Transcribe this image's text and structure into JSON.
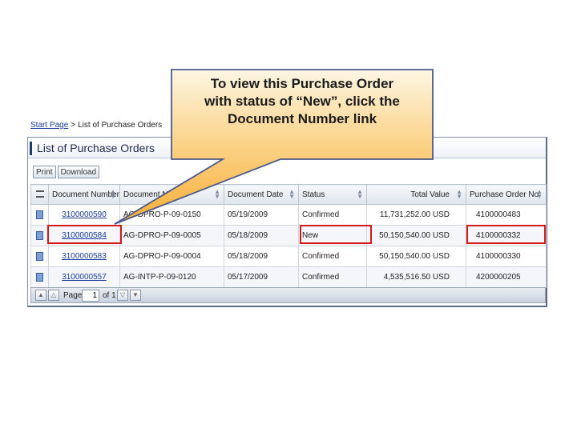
{
  "breadcrumb": {
    "start": "Start Page",
    "separator": ">",
    "current": "List of Purchase Orders"
  },
  "page_title": "List of Purchase Orders",
  "toolbar": {
    "print_label": "Print",
    "download_label": "Download"
  },
  "table": {
    "headers": [
      "Document Number",
      "Document Name",
      "Document Date",
      "Status",
      "Total Value",
      "Purchase Order No."
    ],
    "rows": [
      {
        "doc_number": "3100000590",
        "doc_name": "AG-DPRO-P-09-0150",
        "doc_date": "05/19/2009",
        "status": "Confirmed",
        "total_value": "11,731,252.00 USD",
        "po_number": "4100000483"
      },
      {
        "doc_number": "3100000584",
        "doc_name": "AG-DPRO-P-09-0005",
        "doc_date": "05/18/2009",
        "status": "New",
        "total_value": "50,150,540.00 USD",
        "po_number": "4100000332"
      },
      {
        "doc_number": "3100000583",
        "doc_name": "AG-DPRO-P-09-0004",
        "doc_date": "05/18/2009",
        "status": "Confirmed",
        "total_value": "50,150,540.00 USD",
        "po_number": "4100000330"
      },
      {
        "doc_number": "3100000557",
        "doc_name": "AG-INTP-P-09-0120",
        "doc_date": "05/17/2009",
        "status": "Confirmed",
        "total_value": "4,535,516.50 USD",
        "po_number": "4200000205"
      }
    ]
  },
  "pager": {
    "page_label": "Page",
    "page_value": "1",
    "of_label": "of 1"
  },
  "callout": {
    "line1": "To view this Purchase Order",
    "line2": "with status of “New”, click the",
    "line3": "Document Number link"
  },
  "colors": {
    "highlight": "#d11a1a",
    "callout_top": "#fdf6e3",
    "callout_bottom": "#f9b23c",
    "link": "#1a3c9c"
  }
}
